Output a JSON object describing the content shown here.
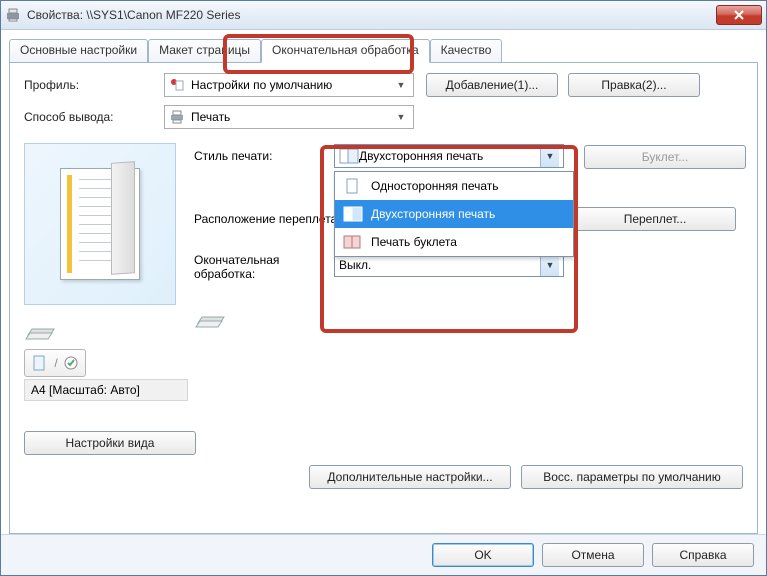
{
  "window": {
    "title": "Свойства: \\\\SYS1\\Canon MF220 Series"
  },
  "tabs": {
    "items": [
      {
        "label": "Основные настройки"
      },
      {
        "label": "Макет страницы"
      },
      {
        "label": "Окончательная обработка",
        "active": true
      },
      {
        "label": "Качество"
      }
    ]
  },
  "profile": {
    "label": "Профиль:",
    "value": "Настройки по умолчанию",
    "add_btn": "Добавление(1)...",
    "edit_btn": "Правка(2)..."
  },
  "output": {
    "label": "Способ вывода:",
    "value": "Печать"
  },
  "preview": {
    "status": "A4 [Масштаб: Авто]",
    "view_settings_btn": "Настройки вида"
  },
  "print_style": {
    "label": "Стиль печати:",
    "selected": "Двухсторонняя печать",
    "options": [
      "Односторонняя печать",
      "Двухсторонняя печать",
      "Печать буклета"
    ],
    "booklet_btn": "Буклет..."
  },
  "binding": {
    "label": "Расположение переплета:",
    "gutter_btn": "Переплет..."
  },
  "finishing": {
    "label": "Окончательная обработка:",
    "value": "Выкл."
  },
  "footer": {
    "advanced_btn": "Дополнительные настройки...",
    "restore_btn": "Восс. параметры по умолчанию"
  },
  "dialog": {
    "ok": "OK",
    "cancel": "Отмена",
    "help": "Справка"
  }
}
